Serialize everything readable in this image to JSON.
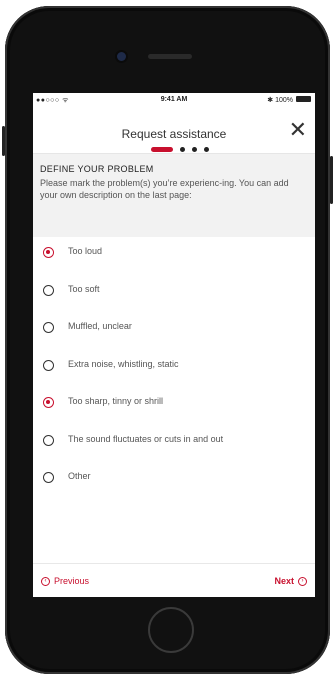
{
  "status_bar": {
    "signal": "●●○○○ ᯤ",
    "time": "9:41 AM",
    "battery": "✱ 100%"
  },
  "header": {
    "title": "Request assistance",
    "close_symbol": "✕",
    "progress": {
      "total_steps": 4,
      "current_step": 1
    }
  },
  "problem": {
    "section_title": "DEFINE YOUR PROBLEM",
    "instructions": "Please mark the problem(s) you’re experienc-ing. You can add your own description on the last page:"
  },
  "options": [
    {
      "label": "Too loud",
      "checked": true
    },
    {
      "label": "Too soft",
      "checked": false
    },
    {
      "label": "Muffled, unclear",
      "checked": false
    },
    {
      "label": "Extra noise, whistling, static",
      "checked": false
    },
    {
      "label": "Too sharp, tinny or shrill",
      "checked": true
    },
    {
      "label": "The sound fluctuates or cuts in and out",
      "checked": false
    },
    {
      "label": "Other",
      "checked": false
    }
  ],
  "footer": {
    "previous_label": "Previous",
    "next_label": "Next"
  },
  "colors": {
    "accent": "#c8102e",
    "header_background": "#f2f2f2"
  }
}
